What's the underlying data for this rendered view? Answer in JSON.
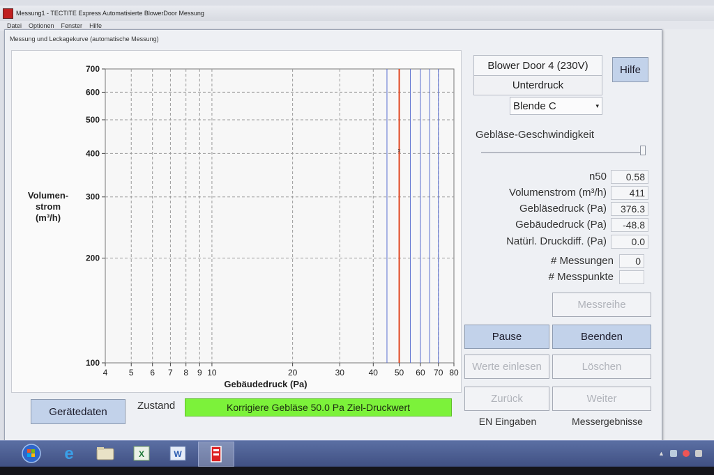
{
  "window": {
    "title": "Messung1 - TECTITE Express Automatisierte BlowerDoor Messung",
    "menu": [
      "Datei",
      "Optionen",
      "Fenster",
      "Hilfe"
    ]
  },
  "dialog": {
    "title": "Messung und Leckagekurve (automatische Messung)",
    "device": "Blower Door 4 (230V)",
    "mode": "Unterdruck",
    "blende": "Blende C",
    "help_label": "Hilfe",
    "fan_speed_label": "Gebläse-Geschwindigkeit",
    "readouts": [
      {
        "label": "n50",
        "value": "0.58"
      },
      {
        "label": "Volumenstrom (m³/h)",
        "value": "411"
      },
      {
        "label": "Gebläsedruck (Pa)",
        "value": "376.3"
      },
      {
        "label": "Gebäudedruck (Pa)",
        "value": "-48.8"
      },
      {
        "label": "Natürl. Druckdiff. (Pa)",
        "value": "0.0"
      }
    ],
    "messungen_label": "# Messungen",
    "messungen_value": "0",
    "messpunkte_label": "# Messpunkte",
    "messpunkte_value": "",
    "buttons": {
      "messreihe": "Messreihe",
      "pause": "Pause",
      "beenden": "Beenden",
      "werte_einlesen": "Werte einlesen",
      "loeschen": "Löschen",
      "zurueck": "Zurück",
      "weiter": "Weiter",
      "geraetedaten": "Gerätedaten"
    },
    "footer_en_eingaben": "EN Eingaben",
    "footer_messergebnisse": "Messergebnisse",
    "zustand_label": "Zustand",
    "status_text": "Korrigiere Gebläse 50.0 Pa Ziel-Druckwert"
  },
  "chart_data": {
    "type": "line",
    "xscale": "log",
    "yscale": "log",
    "xlim": [
      4,
      80
    ],
    "ylim": [
      100,
      700
    ],
    "xticks": [
      4,
      5,
      6,
      7,
      8,
      9,
      10,
      20,
      30,
      40,
      50,
      60,
      70,
      80
    ],
    "yticks": [
      100,
      200,
      300,
      400,
      500,
      600,
      700
    ],
    "xlabel": "Gebäudedruck (Pa)",
    "ylabel_lines": [
      "Volumen-",
      "strom",
      "(m³/h)"
    ],
    "grid": true,
    "blue_vertical_lines_x": [
      45,
      55,
      60,
      65,
      70
    ],
    "target_line_x": 50,
    "marker": {
      "x": 50,
      "y": 411
    },
    "colors": {
      "grid": "#9a9a9a",
      "blue_lines": "#5a6fd0",
      "target_line": "#e0451f"
    }
  },
  "taskbar": {
    "icons": [
      "windows-start-icon",
      "internet-explorer-icon",
      "file-explorer-icon",
      "excel-icon",
      "word-icon",
      "tectite-app-icon"
    ]
  },
  "colors": {
    "status_green": "#7cf23a",
    "button_active": "#c2d2ea"
  }
}
